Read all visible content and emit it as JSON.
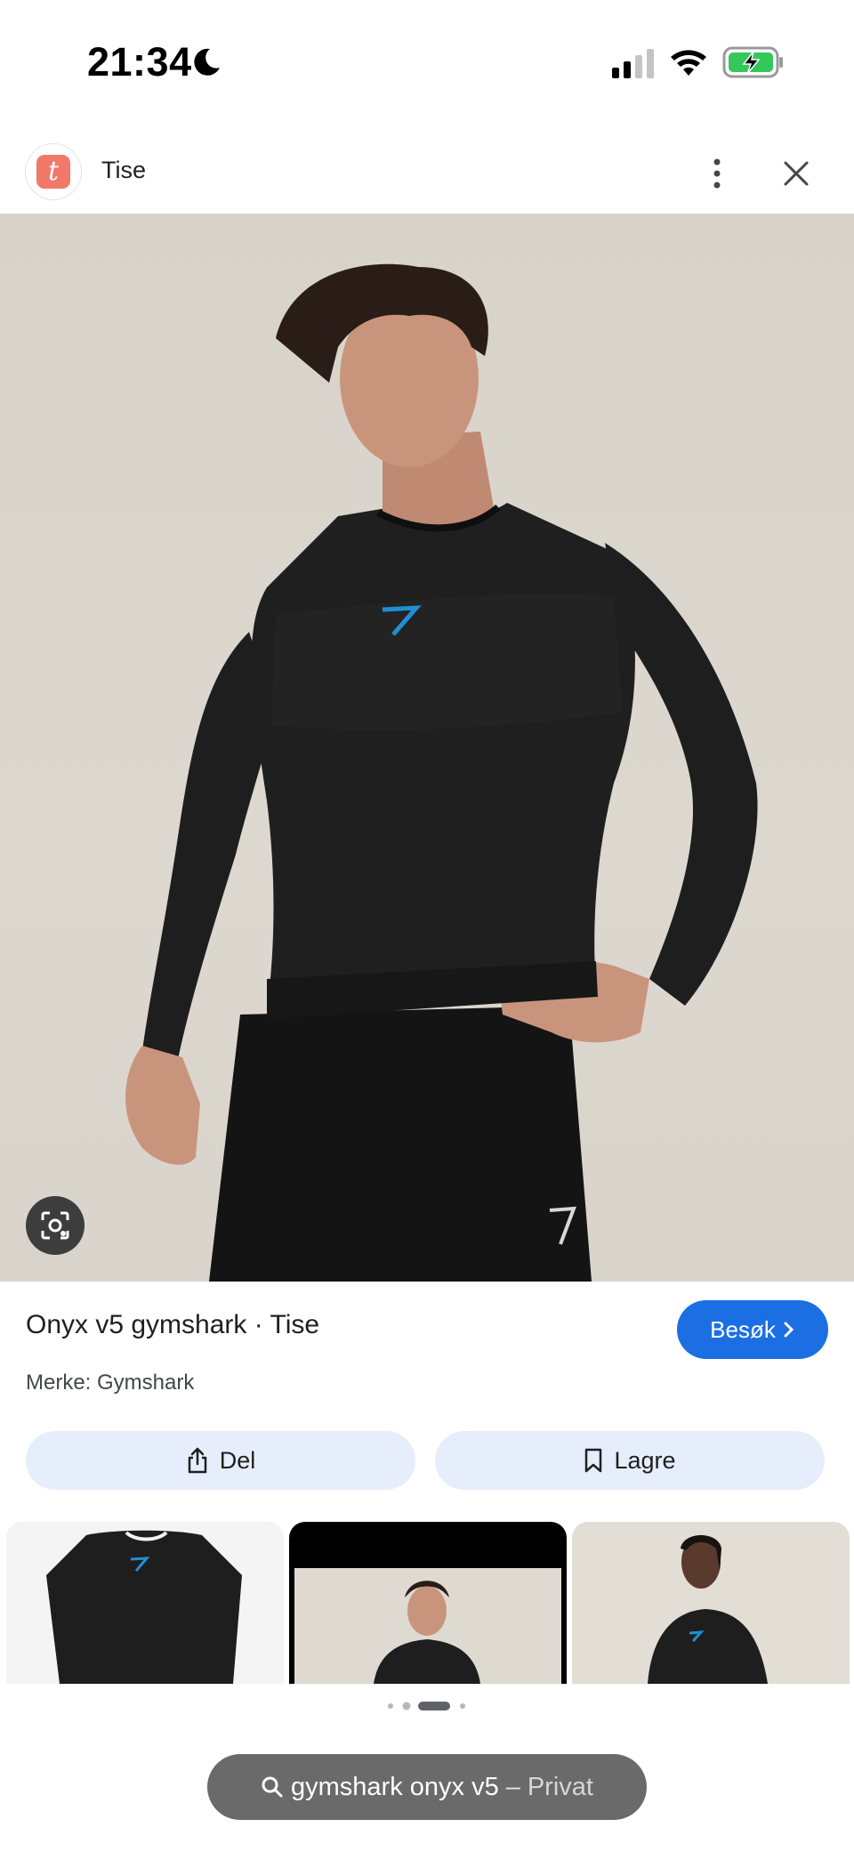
{
  "status_bar": {
    "time": "21:34",
    "icons": [
      "moon-icon",
      "signal-icon",
      "wifi-icon",
      "battery-charging-icon"
    ]
  },
  "header": {
    "favicon_letter": "t",
    "site_name": "Tise",
    "icons": [
      "more-vert-icon",
      "close-icon"
    ]
  },
  "product": {
    "title": "Onyx v5 gymshark · Tise",
    "brand": "Merke: Gymshark",
    "visit_label": "Besøk",
    "share_label": "Del",
    "save_label": "Lagre"
  },
  "thumbnails": {
    "count": 3,
    "active_page": 3,
    "page_count": 4
  },
  "search": {
    "query": "gymshark onyx v5",
    "separator": "–",
    "mode": "Privat"
  },
  "colors": {
    "accent": "#1b6fe3",
    "chip_bg": "#e6eefc",
    "brand_tise": "#f1796a",
    "battery_green": "#34c759",
    "shirt": "#1e1e1e",
    "logo_blue": "#1f8fd6"
  }
}
